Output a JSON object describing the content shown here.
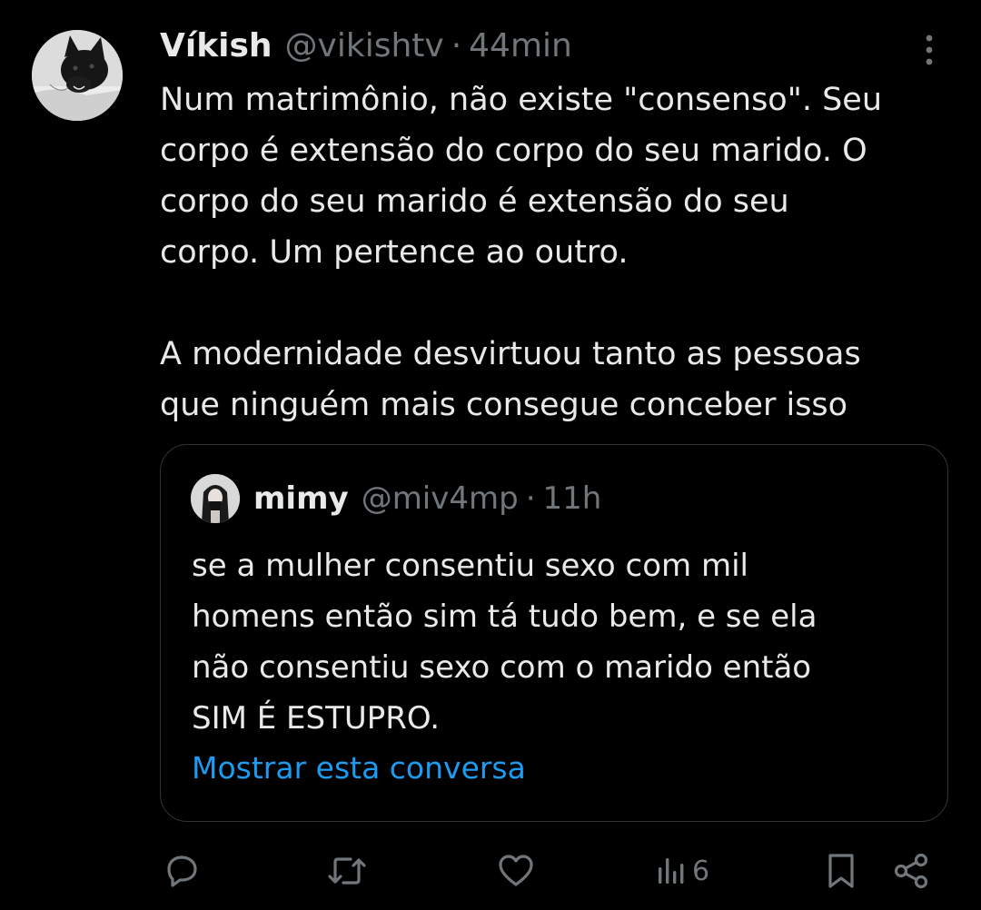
{
  "tweet": {
    "display_name": "Víkish",
    "handle": "@vikishtv",
    "separator": "·",
    "time": "44min",
    "text": "Num matrimônio, não existe \"consenso\". Seu\ncorpo é extensão do corpo do seu marido. O\ncorpo do seu marido é extensão do seu\ncorpo. Um pertence ao outro.\n\nA modernidade desvirtuou tanto as pessoas\nque ninguém mais consegue conceber isso"
  },
  "quote": {
    "display_name": "mimy",
    "handle": "@miv4mp",
    "separator": "·",
    "time": "11h",
    "text": "se a mulher consentiu sexo com mil\nhomens então sim tá tudo bem, e se ela\nnão consentiu sexo com o marido então\nSIM É ESTUPRO.",
    "show_conversation": "Mostrar esta conversa"
  },
  "actions": {
    "reply_icon": "reply-icon",
    "retweet_icon": "retweet-icon",
    "like_icon": "heart-icon",
    "views_icon": "views-icon",
    "views_count": "6",
    "bookmark_icon": "bookmark-icon",
    "share_icon": "share-icon"
  },
  "colors": {
    "background": "#000000",
    "text_primary": "#e7e9ea",
    "text_secondary": "#71767b",
    "link": "#1d9bf0",
    "border": "#2f3336"
  }
}
